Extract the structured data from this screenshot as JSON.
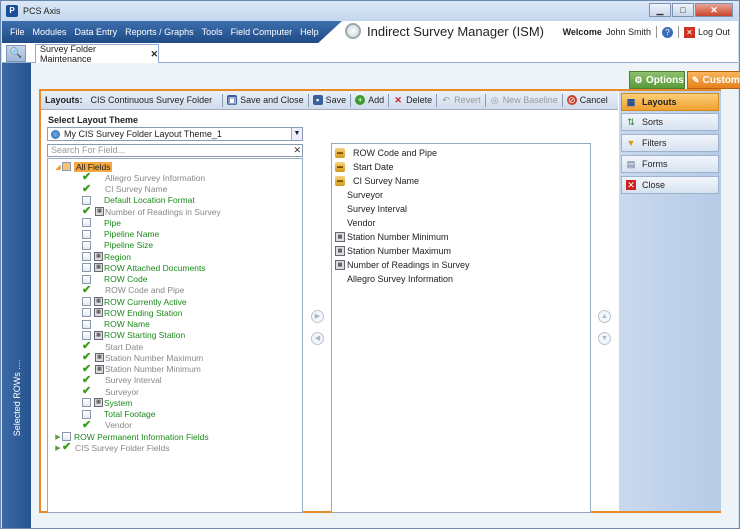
{
  "window": {
    "title": "PCS Axis",
    "app_icon": "P",
    "minimize": "▁",
    "maximize": "□",
    "close": "✕"
  },
  "menu": {
    "items": [
      "File",
      "Modules",
      "Data Entry",
      "Reports / Graphs",
      "Tools",
      "Field Computer",
      "Help"
    ]
  },
  "app_title": "Indirect Survey Manager (ISM)",
  "user": {
    "welcome": "Welcome",
    "name": "John Smith",
    "help_glyph": "?",
    "logout": "Log Out",
    "logout_glyph": "✕"
  },
  "tabs": {
    "search_glyph": "🔍",
    "doc_tab": "Survey Folder Maintenance",
    "doc_close": "✕"
  },
  "left_rail": {
    "label": "Selected ROWs",
    "dots": "...."
  },
  "top_buttons": {
    "options": "Options",
    "customize": "Customize"
  },
  "toolbar": {
    "layouts_label": "Layouts:",
    "layout_name": "CIS Continuous Survey Folder",
    "save_close": "Save and Close",
    "save": "Save",
    "add": "Add",
    "delete": "Delete",
    "revert": "Revert",
    "new_baseline": "New Baseline",
    "cancel": "Cancel"
  },
  "side_nav": {
    "items": [
      "Layouts",
      "Sorts",
      "Filters",
      "Forms",
      "Close"
    ]
  },
  "theme": {
    "label": "Select Layout Theme",
    "selected": "My CIS Survey Folder Layout Theme_1",
    "dropdown_glyph": "▼"
  },
  "find": {
    "placeholder": "Search For Field...",
    "clear_glyph": "✕"
  },
  "tree": {
    "root": "All Fields",
    "items": [
      {
        "label": "Allegro Survey Information",
        "checked": true,
        "calc": false,
        "color": "gray"
      },
      {
        "label": "CI Survey Name",
        "checked": true,
        "calc": false,
        "color": "gray"
      },
      {
        "label": "Default Location Format",
        "checked": false,
        "calc": false,
        "color": "green"
      },
      {
        "label": "Number of Readings in Survey",
        "checked": true,
        "calc": true,
        "color": "gray"
      },
      {
        "label": "Pipe",
        "checked": false,
        "calc": false,
        "color": "green"
      },
      {
        "label": "Pipeline Name",
        "checked": false,
        "calc": false,
        "color": "green"
      },
      {
        "label": "Pipeline Size",
        "checked": false,
        "calc": false,
        "color": "green"
      },
      {
        "label": "Region",
        "checked": false,
        "calc": true,
        "color": "green"
      },
      {
        "label": "ROW Attached Documents",
        "checked": false,
        "calc": true,
        "color": "green"
      },
      {
        "label": "ROW Code",
        "checked": false,
        "calc": false,
        "color": "green"
      },
      {
        "label": "ROW Code and Pipe",
        "checked": true,
        "calc": false,
        "color": "gray"
      },
      {
        "label": "ROW Currently Active",
        "checked": false,
        "calc": true,
        "color": "green"
      },
      {
        "label": "ROW Ending Station",
        "checked": false,
        "calc": true,
        "color": "green"
      },
      {
        "label": "ROW Name",
        "checked": false,
        "calc": false,
        "color": "green"
      },
      {
        "label": "ROW Starting Station",
        "checked": false,
        "calc": true,
        "color": "green"
      },
      {
        "label": "Start Date",
        "checked": true,
        "calc": false,
        "color": "gray"
      },
      {
        "label": "Station Number Maximum",
        "checked": true,
        "calc": true,
        "color": "gray"
      },
      {
        "label": "Station Number Minimum",
        "checked": true,
        "calc": true,
        "color": "gray"
      },
      {
        "label": "Survey Interval",
        "checked": true,
        "calc": false,
        "color": "gray"
      },
      {
        "label": "Surveyor",
        "checked": true,
        "calc": false,
        "color": "gray"
      },
      {
        "label": "System",
        "checked": false,
        "calc": true,
        "color": "green"
      },
      {
        "label": "Total Footage",
        "checked": false,
        "calc": false,
        "color": "green"
      },
      {
        "label": "Vendor",
        "checked": true,
        "calc": false,
        "color": "gray"
      }
    ],
    "groups": [
      {
        "label": "ROW Permanent Information Fields",
        "checked": false,
        "color": "green"
      },
      {
        "label": "CIS Survey Folder Fields",
        "checked": true,
        "color": "gray"
      }
    ]
  },
  "selected_fields": [
    {
      "label": "ROW Code and Pipe",
      "icon": "lock"
    },
    {
      "label": "Start Date",
      "icon": "lock"
    },
    {
      "label": "CI Survey Name",
      "icon": "lock"
    },
    {
      "label": "Surveyor",
      "icon": "none"
    },
    {
      "label": "Survey Interval",
      "icon": "none"
    },
    {
      "label": "Vendor",
      "icon": "none"
    },
    {
      "label": "Station Number Minimum",
      "icon": "calc"
    },
    {
      "label": "Station Number Maximum",
      "icon": "calc"
    },
    {
      "label": "Number of Readings in Survey",
      "icon": "calc"
    },
    {
      "label": "Allegro Survey Information",
      "icon": "none"
    }
  ],
  "colors": {
    "accent_orange": "#e88a2a",
    "menu_blue": "#2a5a96",
    "green_text": "#1a8a1a"
  }
}
